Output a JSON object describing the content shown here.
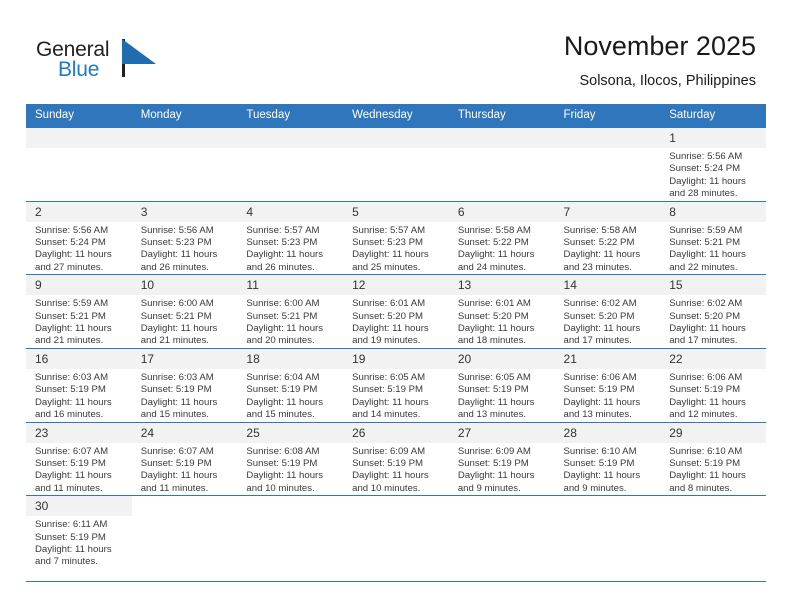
{
  "brand": {
    "name_part1": "General",
    "name_part2": "Blue",
    "logo_icon": "blue-triangle-flag-icon"
  },
  "header": {
    "title": "November 2025",
    "subtitle": "Solsona, Ilocos, Philippines"
  },
  "colors": {
    "accent": "#2f76bc",
    "brand_blue": "#1f7bc1",
    "daynum_bg": "#f2f2f2",
    "text": "#1a1a1a"
  },
  "weekdays": [
    "Sunday",
    "Monday",
    "Tuesday",
    "Wednesday",
    "Thursday",
    "Friday",
    "Saturday"
  ],
  "weeks": [
    [
      {
        "day": "",
        "empty": true
      },
      {
        "day": "",
        "empty": true
      },
      {
        "day": "",
        "empty": true
      },
      {
        "day": "",
        "empty": true
      },
      {
        "day": "",
        "empty": true
      },
      {
        "day": "",
        "empty": true
      },
      {
        "day": "1",
        "sunrise": "Sunrise: 5:56 AM",
        "sunset": "Sunset: 5:24 PM",
        "daylight": "Daylight: 11 hours and 28 minutes."
      }
    ],
    [
      {
        "day": "2",
        "sunrise": "Sunrise: 5:56 AM",
        "sunset": "Sunset: 5:24 PM",
        "daylight": "Daylight: 11 hours and 27 minutes."
      },
      {
        "day": "3",
        "sunrise": "Sunrise: 5:56 AM",
        "sunset": "Sunset: 5:23 PM",
        "daylight": "Daylight: 11 hours and 26 minutes."
      },
      {
        "day": "4",
        "sunrise": "Sunrise: 5:57 AM",
        "sunset": "Sunset: 5:23 PM",
        "daylight": "Daylight: 11 hours and 26 minutes."
      },
      {
        "day": "5",
        "sunrise": "Sunrise: 5:57 AM",
        "sunset": "Sunset: 5:23 PM",
        "daylight": "Daylight: 11 hours and 25 minutes."
      },
      {
        "day": "6",
        "sunrise": "Sunrise: 5:58 AM",
        "sunset": "Sunset: 5:22 PM",
        "daylight": "Daylight: 11 hours and 24 minutes."
      },
      {
        "day": "7",
        "sunrise": "Sunrise: 5:58 AM",
        "sunset": "Sunset: 5:22 PM",
        "daylight": "Daylight: 11 hours and 23 minutes."
      },
      {
        "day": "8",
        "sunrise": "Sunrise: 5:59 AM",
        "sunset": "Sunset: 5:21 PM",
        "daylight": "Daylight: 11 hours and 22 minutes."
      }
    ],
    [
      {
        "day": "9",
        "sunrise": "Sunrise: 5:59 AM",
        "sunset": "Sunset: 5:21 PM",
        "daylight": "Daylight: 11 hours and 21 minutes."
      },
      {
        "day": "10",
        "sunrise": "Sunrise: 6:00 AM",
        "sunset": "Sunset: 5:21 PM",
        "daylight": "Daylight: 11 hours and 21 minutes."
      },
      {
        "day": "11",
        "sunrise": "Sunrise: 6:00 AM",
        "sunset": "Sunset: 5:21 PM",
        "daylight": "Daylight: 11 hours and 20 minutes."
      },
      {
        "day": "12",
        "sunrise": "Sunrise: 6:01 AM",
        "sunset": "Sunset: 5:20 PM",
        "daylight": "Daylight: 11 hours and 19 minutes."
      },
      {
        "day": "13",
        "sunrise": "Sunrise: 6:01 AM",
        "sunset": "Sunset: 5:20 PM",
        "daylight": "Daylight: 11 hours and 18 minutes."
      },
      {
        "day": "14",
        "sunrise": "Sunrise: 6:02 AM",
        "sunset": "Sunset: 5:20 PM",
        "daylight": "Daylight: 11 hours and 17 minutes."
      },
      {
        "day": "15",
        "sunrise": "Sunrise: 6:02 AM",
        "sunset": "Sunset: 5:20 PM",
        "daylight": "Daylight: 11 hours and 17 minutes."
      }
    ],
    [
      {
        "day": "16",
        "sunrise": "Sunrise: 6:03 AM",
        "sunset": "Sunset: 5:19 PM",
        "daylight": "Daylight: 11 hours and 16 minutes."
      },
      {
        "day": "17",
        "sunrise": "Sunrise: 6:03 AM",
        "sunset": "Sunset: 5:19 PM",
        "daylight": "Daylight: 11 hours and 15 minutes."
      },
      {
        "day": "18",
        "sunrise": "Sunrise: 6:04 AM",
        "sunset": "Sunset: 5:19 PM",
        "daylight": "Daylight: 11 hours and 15 minutes."
      },
      {
        "day": "19",
        "sunrise": "Sunrise: 6:05 AM",
        "sunset": "Sunset: 5:19 PM",
        "daylight": "Daylight: 11 hours and 14 minutes."
      },
      {
        "day": "20",
        "sunrise": "Sunrise: 6:05 AM",
        "sunset": "Sunset: 5:19 PM",
        "daylight": "Daylight: 11 hours and 13 minutes."
      },
      {
        "day": "21",
        "sunrise": "Sunrise: 6:06 AM",
        "sunset": "Sunset: 5:19 PM",
        "daylight": "Daylight: 11 hours and 13 minutes."
      },
      {
        "day": "22",
        "sunrise": "Sunrise: 6:06 AM",
        "sunset": "Sunset: 5:19 PM",
        "daylight": "Daylight: 11 hours and 12 minutes."
      }
    ],
    [
      {
        "day": "23",
        "sunrise": "Sunrise: 6:07 AM",
        "sunset": "Sunset: 5:19 PM",
        "daylight": "Daylight: 11 hours and 11 minutes."
      },
      {
        "day": "24",
        "sunrise": "Sunrise: 6:07 AM",
        "sunset": "Sunset: 5:19 PM",
        "daylight": "Daylight: 11 hours and 11 minutes."
      },
      {
        "day": "25",
        "sunrise": "Sunrise: 6:08 AM",
        "sunset": "Sunset: 5:19 PM",
        "daylight": "Daylight: 11 hours and 10 minutes."
      },
      {
        "day": "26",
        "sunrise": "Sunrise: 6:09 AM",
        "sunset": "Sunset: 5:19 PM",
        "daylight": "Daylight: 11 hours and 10 minutes."
      },
      {
        "day": "27",
        "sunrise": "Sunrise: 6:09 AM",
        "sunset": "Sunset: 5:19 PM",
        "daylight": "Daylight: 11 hours and 9 minutes."
      },
      {
        "day": "28",
        "sunrise": "Sunrise: 6:10 AM",
        "sunset": "Sunset: 5:19 PM",
        "daylight": "Daylight: 11 hours and 9 minutes."
      },
      {
        "day": "29",
        "sunrise": "Sunrise: 6:10 AM",
        "sunset": "Sunset: 5:19 PM",
        "daylight": "Daylight: 11 hours and 8 minutes."
      }
    ],
    [
      {
        "day": "30",
        "sunrise": "Sunrise: 6:11 AM",
        "sunset": "Sunset: 5:19 PM",
        "daylight": "Daylight: 11 hours and 7 minutes."
      },
      {
        "day": "",
        "blank": true
      },
      {
        "day": "",
        "blank": true
      },
      {
        "day": "",
        "blank": true
      },
      {
        "day": "",
        "blank": true
      },
      {
        "day": "",
        "blank": true
      },
      {
        "day": "",
        "blank": true
      }
    ]
  ]
}
